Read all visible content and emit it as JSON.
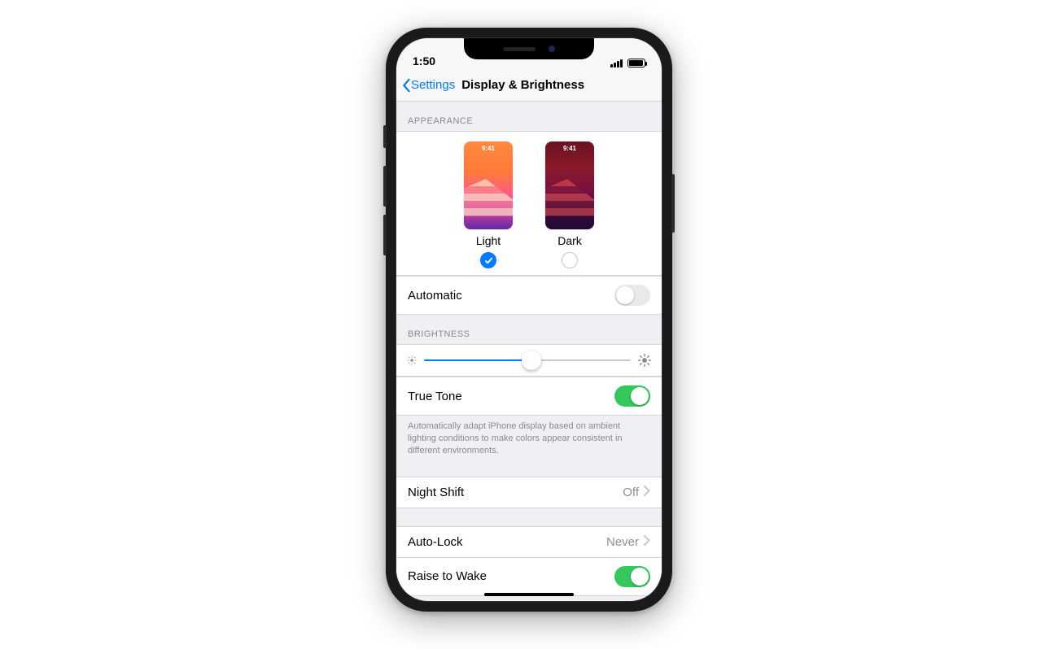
{
  "status": {
    "time": "1:50"
  },
  "nav": {
    "back": "Settings",
    "title": "Display & Brightness"
  },
  "appearance": {
    "header": "APPEARANCE",
    "preview_time": "9:41",
    "light_label": "Light",
    "dark_label": "Dark",
    "selected": "light",
    "automatic_label": "Automatic",
    "automatic_on": false
  },
  "brightness": {
    "header": "BRIGHTNESS",
    "value_percent": 52,
    "truetone_label": "True Tone",
    "truetone_on": true,
    "truetone_footer": "Automatically adapt iPhone display based on ambient lighting conditions to make colors appear consistent in different environments."
  },
  "nightshift": {
    "label": "Night Shift",
    "value": "Off"
  },
  "autolock": {
    "label": "Auto-Lock",
    "value": "Never"
  },
  "raise": {
    "label": "Raise to Wake",
    "on": true
  }
}
